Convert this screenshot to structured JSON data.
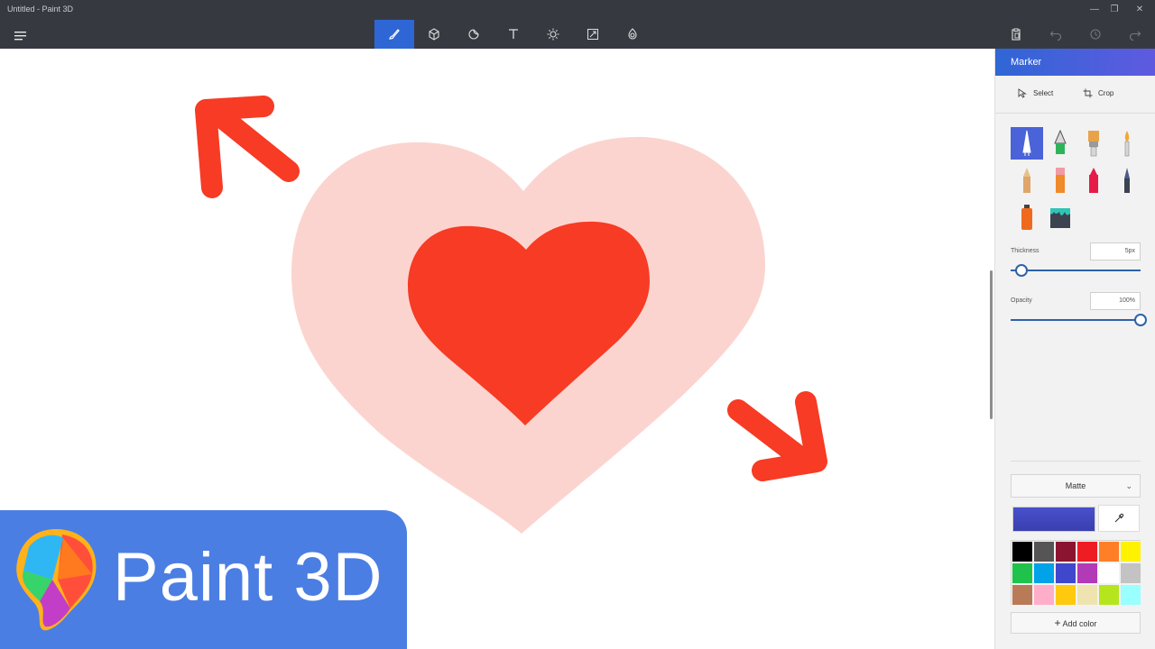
{
  "window": {
    "title": "Untitled - Paint 3D",
    "minimize": "—",
    "restore": "❐",
    "close": "✕"
  },
  "toolbar": {
    "tools": [
      {
        "name": "brushes",
        "icon": "brush-icon",
        "active": true
      },
      {
        "name": "3d-shapes",
        "icon": "cube-icon",
        "active": false
      },
      {
        "name": "stickers",
        "icon": "sticker-icon",
        "active": false
      },
      {
        "name": "text",
        "icon": "text-icon",
        "active": false
      },
      {
        "name": "effects",
        "icon": "sun-icon",
        "active": false
      },
      {
        "name": "canvas",
        "icon": "resize-icon",
        "active": false
      },
      {
        "name": "3d-library",
        "icon": "library-icon",
        "active": false
      }
    ],
    "right": [
      "paste-icon",
      "undo-icon",
      "history-icon",
      "redo-icon"
    ]
  },
  "panel": {
    "title": "Marker",
    "select_label": "Select",
    "crop_label": "Crop",
    "thickness_label": "Thickness",
    "thickness_value": "5px",
    "thickness_level": 0.08,
    "opacity_label": "Opacity",
    "opacity_value": "100%",
    "opacity_level": 1.0,
    "finish": "Matte",
    "add_color_label": "Add color",
    "current_color": "#4850cc",
    "brushes": [
      "marker",
      "calligraphy-pen",
      "oil-brush",
      "watercolor",
      "pencil",
      "eraser",
      "crayon",
      "pixel-pen",
      "spray-can",
      "fill-bucket"
    ]
  },
  "palette": [
    "#000000",
    "#555555",
    "#8b1530",
    "#ee1d24",
    "#ff7f27",
    "#fff200",
    "#1fc24a",
    "#00a2e8",
    "#3f48cc",
    "#b23ab6",
    "#ffffff",
    "#c3c3c3",
    "#b97a57",
    "#ffaec9",
    "#ffc90e",
    "#efe4b0",
    "#b5e61d",
    "#99ffff"
  ],
  "canvas": {
    "outer_heart_color": "#fcd4cf",
    "inner_heart_color": "#f73b24",
    "arrow_color": "#f73b24"
  },
  "banner": {
    "text": "Paint 3D"
  }
}
